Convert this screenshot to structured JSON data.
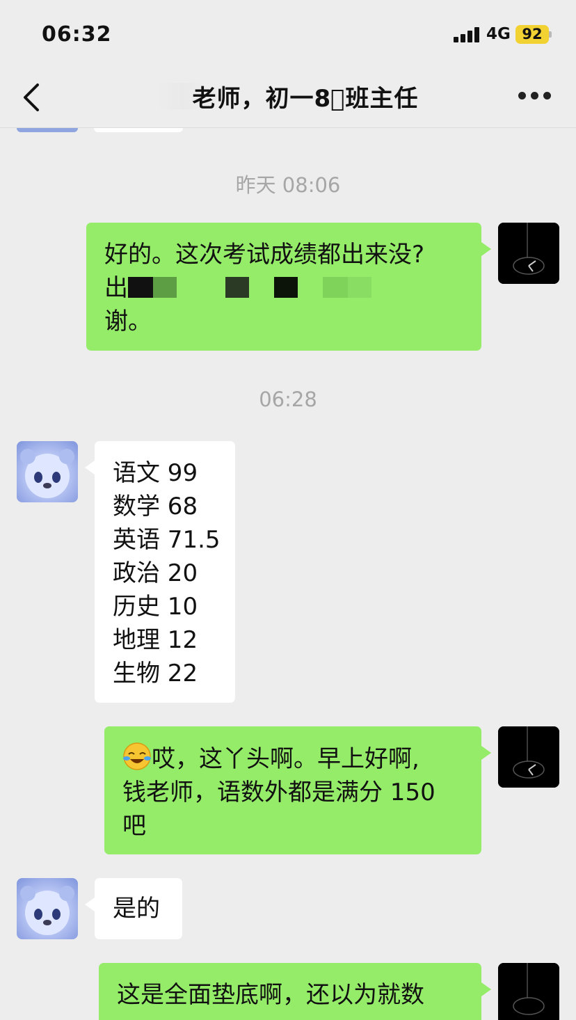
{
  "status_bar": {
    "time": "06:32",
    "network": "4G",
    "battery": "92"
  },
  "nav": {
    "title": "老师，初一8⃣班主任"
  },
  "timestamps": {
    "t1": "昨天 08:06",
    "t2": "06:28"
  },
  "messages": {
    "m1": {
      "line1": "好的。这次考试成绩都出来没?",
      "line2_start": "出",
      "line3": "谢。"
    },
    "m2": {
      "lines": [
        "语文 99",
        "数学 68",
        "英语 71.5",
        "政治 20",
        "历史 10",
        "地理 12",
        "生物 22"
      ]
    },
    "m3": {
      "line1": "哎，这丫头啊。早上好啊,",
      "line2": "钱老师，语数外都是满分 150",
      "line3": "吧"
    },
    "m4": {
      "text": "是的"
    },
    "m5": {
      "line1": "这是全面垫底啊，还以为就数"
    }
  },
  "colors": {
    "sent_bubble": "#95ec69",
    "received_bubble": "#ffffff",
    "background": "#ededed",
    "battery": "#f2d233"
  },
  "icons": {
    "back": "chevron-left-icon",
    "more": "more-dots-icon",
    "signal": "signal-icon",
    "emoji": "crying-laughing-emoji-icon"
  }
}
